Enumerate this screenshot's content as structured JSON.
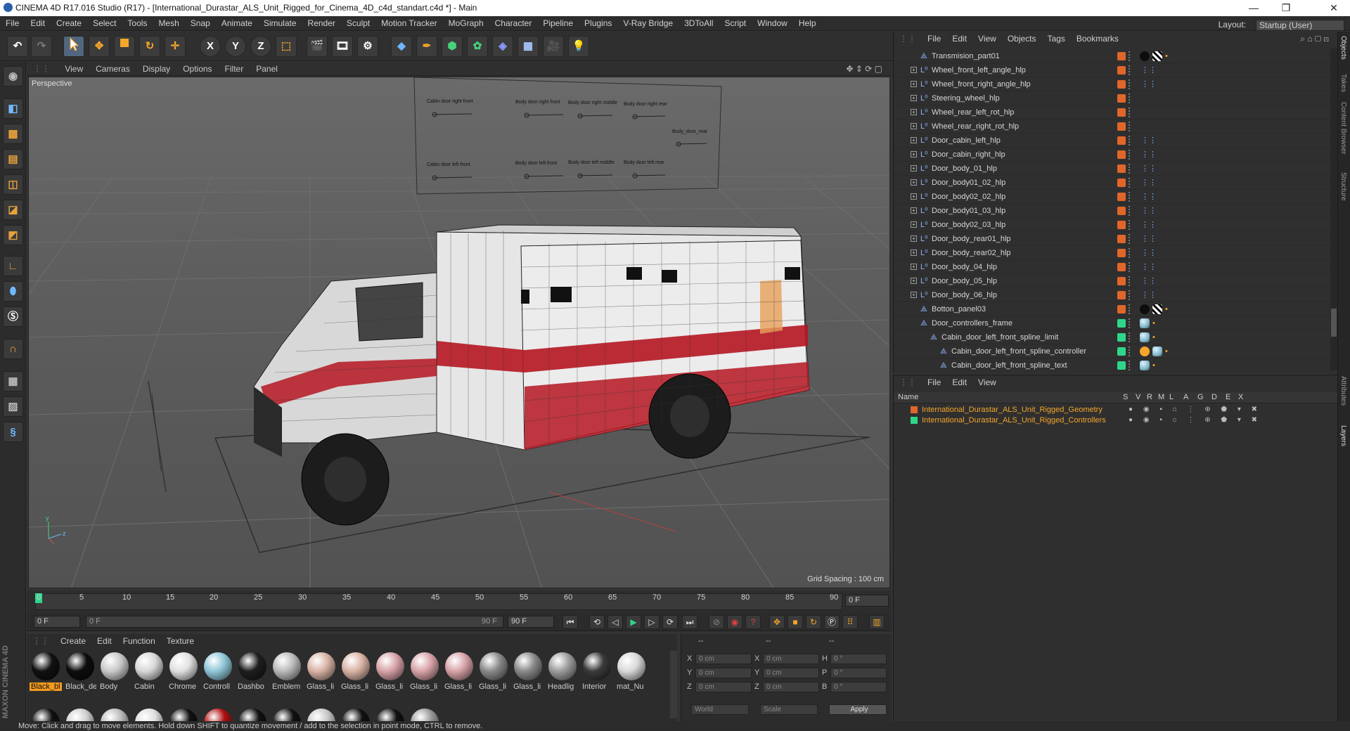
{
  "titlebar": {
    "title": "CINEMA 4D R17.016 Studio (R17) - [International_Durastar_ALS_Unit_Rigged_for_Cinema_4D_c4d_standart.c4d *] - Main",
    "minimize": "—",
    "maximize": "❐",
    "close": "✕"
  },
  "menu": [
    "File",
    "Edit",
    "Create",
    "Select",
    "Tools",
    "Mesh",
    "Snap",
    "Animate",
    "Simulate",
    "Render",
    "Sculpt",
    "Motion Tracker",
    "MoGraph",
    "Character",
    "Pipeline",
    "Plugins",
    "V-Ray Bridge",
    "3DToAll",
    "Script",
    "Window",
    "Help"
  ],
  "layout": {
    "label": "Layout:",
    "value": "Startup (User)"
  },
  "toolbar": {
    "undo": "↶",
    "redo": "↷",
    "x": "X",
    "y": "Y",
    "z": "Z"
  },
  "viewport": {
    "menu": [
      "View",
      "Cameras",
      "Display",
      "Options",
      "Filter",
      "Panel"
    ],
    "label": "Perspective",
    "grid_spacing": "Grid Spacing : 100 cm"
  },
  "board_labels": [
    "Cabin door right front",
    "Body door right front",
    "Body door right middle",
    "Body door right rear",
    "Body_door_rear",
    "Cabin door left front",
    "Body door left front",
    "Body door left middle",
    "Body door left rear"
  ],
  "timeline": {
    "ticks": [
      "0",
      "5",
      "10",
      "15",
      "20",
      "25",
      "30",
      "35",
      "40",
      "45",
      "50",
      "55",
      "60",
      "65",
      "70",
      "75",
      "80",
      "85",
      "90"
    ],
    "end_field": "0 F",
    "start": "0 F",
    "range_start": "0 F",
    "range_end": "90 F",
    "max": "90 F"
  },
  "materials": {
    "menu": [
      "Create",
      "Edit",
      "Function",
      "Texture"
    ],
    "row1": [
      {
        "name": "Black_bl",
        "color": "#111",
        "active": true
      },
      {
        "name": "Black_de",
        "color": "#0d0d0d"
      },
      {
        "name": "Body",
        "color": "#c9c9c9"
      },
      {
        "name": "Cabin",
        "color": "#d8d8d8"
      },
      {
        "name": "Chrome",
        "color": "#e0e0e0"
      },
      {
        "name": "Controll",
        "color": "#8fc7d8"
      },
      {
        "name": "Dashbo",
        "color": "#1e1e1e"
      },
      {
        "name": "Emblem",
        "color": "#bbbbbb"
      },
      {
        "name": "Glass_li",
        "color": "#d9b3a5"
      },
      {
        "name": "Glass_li",
        "color": "#d9b3a5"
      },
      {
        "name": "Glass_li",
        "color": "#d8a3a8"
      },
      {
        "name": "Glass_li",
        "color": "#d8a3a8"
      },
      {
        "name": "Glass_li",
        "color": "#d8a3a8"
      },
      {
        "name": "Glass_li",
        "color": "#8a8a8a"
      },
      {
        "name": "Glass_li",
        "color": "#8a8a8a"
      },
      {
        "name": "Headlig",
        "color": "#9c9c9c"
      },
      {
        "name": "Interior",
        "color": "#3a3a3a"
      },
      {
        "name": "mat_Nu",
        "color": "#d8d8d8"
      }
    ],
    "row2": [
      "#111",
      "#cfcfcf",
      "#bbb",
      "#ddd",
      "#111",
      "#b01010",
      "#111",
      "#111",
      "#c8c8c8",
      "#111",
      "#111",
      "#9a9a9a"
    ]
  },
  "coords": {
    "header": [
      "--",
      "--",
      "--"
    ],
    "x1": "0 cm",
    "y1": "0 cm",
    "z1": "0 cm",
    "x2": "0 cm",
    "y2": "0 cm",
    "z2": "0 cm",
    "h": "0 °",
    "p": "0 °",
    "b": "0 °",
    "labels": [
      "X",
      "Y",
      "Z",
      "X",
      "Y",
      "Z",
      "H",
      "P",
      "B"
    ],
    "world": "World",
    "scale": "Scale",
    "apply": "Apply"
  },
  "status": "Move: Click and drag to move elements. Hold down SHIFT to quantize movement / add to the selection in point mode, CTRL to remove.",
  "objects": {
    "menu": [
      "File",
      "Edit",
      "View",
      "Objects",
      "Tags",
      "Bookmarks"
    ],
    "rows": [
      {
        "name": "Transmision_part01",
        "indent": 1,
        "icon": "null",
        "color": "#e0662a",
        "tags": "black"
      },
      {
        "name": "Wheel_front_left_angle_hlp",
        "indent": 1,
        "icon": "L0",
        "color": "#e0662a",
        "tags": "dots"
      },
      {
        "name": "Wheel_front_right_angle_hlp",
        "indent": 1,
        "icon": "L0",
        "color": "#e0662a",
        "tags": "dots"
      },
      {
        "name": "Steering_wheel_hlp",
        "indent": 1,
        "icon": "L0",
        "color": "#e0662a",
        "tags": ""
      },
      {
        "name": "Wheel_rear_left_rot_hlp",
        "indent": 1,
        "icon": "L0",
        "color": "#e0662a",
        "tags": ""
      },
      {
        "name": "Wheel_rear_right_rot_hlp",
        "indent": 1,
        "icon": "L0",
        "color": "#e0662a",
        "tags": ""
      },
      {
        "name": "Door_cabin_left_hlp",
        "indent": 1,
        "icon": "L0",
        "color": "#e0662a",
        "tags": "dots"
      },
      {
        "name": "Door_cabin_right_hlp",
        "indent": 1,
        "icon": "L0",
        "color": "#e0662a",
        "tags": "dots"
      },
      {
        "name": "Door_body_01_hlp",
        "indent": 1,
        "icon": "L0",
        "color": "#e0662a",
        "tags": "dots"
      },
      {
        "name": "Door_body01_02_hlp",
        "indent": 1,
        "icon": "L0",
        "color": "#e0662a",
        "tags": "dots"
      },
      {
        "name": "Door_body02_02_hlp",
        "indent": 1,
        "icon": "L0",
        "color": "#e0662a",
        "tags": "dots"
      },
      {
        "name": "Door_body01_03_hlp",
        "indent": 1,
        "icon": "L0",
        "color": "#e0662a",
        "tags": "dots"
      },
      {
        "name": "Door_body02_03_hlp",
        "indent": 1,
        "icon": "L0",
        "color": "#e0662a",
        "tags": "dots"
      },
      {
        "name": "Door_body_rear01_hlp",
        "indent": 1,
        "icon": "L0",
        "color": "#e0662a",
        "tags": "dots"
      },
      {
        "name": "Door_body_rear02_hlp",
        "indent": 1,
        "icon": "L0",
        "color": "#e0662a",
        "tags": "dots"
      },
      {
        "name": "Door_body_04_hlp",
        "indent": 1,
        "icon": "L0",
        "color": "#e0662a",
        "tags": "dots"
      },
      {
        "name": "Door_body_05_hlp",
        "indent": 1,
        "icon": "L0",
        "color": "#e0662a",
        "tags": "dots"
      },
      {
        "name": "Door_body_06_hlp",
        "indent": 1,
        "icon": "L0",
        "color": "#e0662a",
        "tags": "dots"
      },
      {
        "name": "Botton_panel03",
        "indent": 1,
        "icon": "null",
        "color": "#e0662a",
        "tags": "black"
      },
      {
        "name": "Door_controllers_frame",
        "indent": 1,
        "icon": "null",
        "color": "#2fd68a",
        "tags": "blue"
      },
      {
        "name": "Cabin_door_left_front_spline_limit",
        "indent": 2,
        "icon": "null",
        "color": "#2fd68a",
        "tags": "blue"
      },
      {
        "name": "Cabin_door_left_front_spline_controller",
        "indent": 3,
        "icon": "null",
        "color": "#2fd68a",
        "tags": "ctrl"
      },
      {
        "name": "Cabin_door_left_front_spline_text",
        "indent": 3,
        "icon": "null",
        "color": "#2fd68a",
        "tags": "blue"
      }
    ]
  },
  "layers": {
    "menu": [
      "File",
      "Edit",
      "View"
    ],
    "headers": [
      "Name",
      "S",
      "V",
      "R",
      "M",
      "L",
      "A",
      "G",
      "D",
      "E",
      "X"
    ],
    "rows": [
      {
        "name": "International_Durastar_ALS_Unit_Rigged_Geometry",
        "color": "#e0662a"
      },
      {
        "name": "International_Durastar_ALS_Unit_Rigged_Controllers",
        "color": "#2fd68a"
      }
    ]
  },
  "sidetabs": [
    "Objects",
    "Takes",
    "Content Browser",
    "Structure",
    "Attributes",
    "Layers"
  ],
  "brand": "MAXON CINEMA 4D"
}
